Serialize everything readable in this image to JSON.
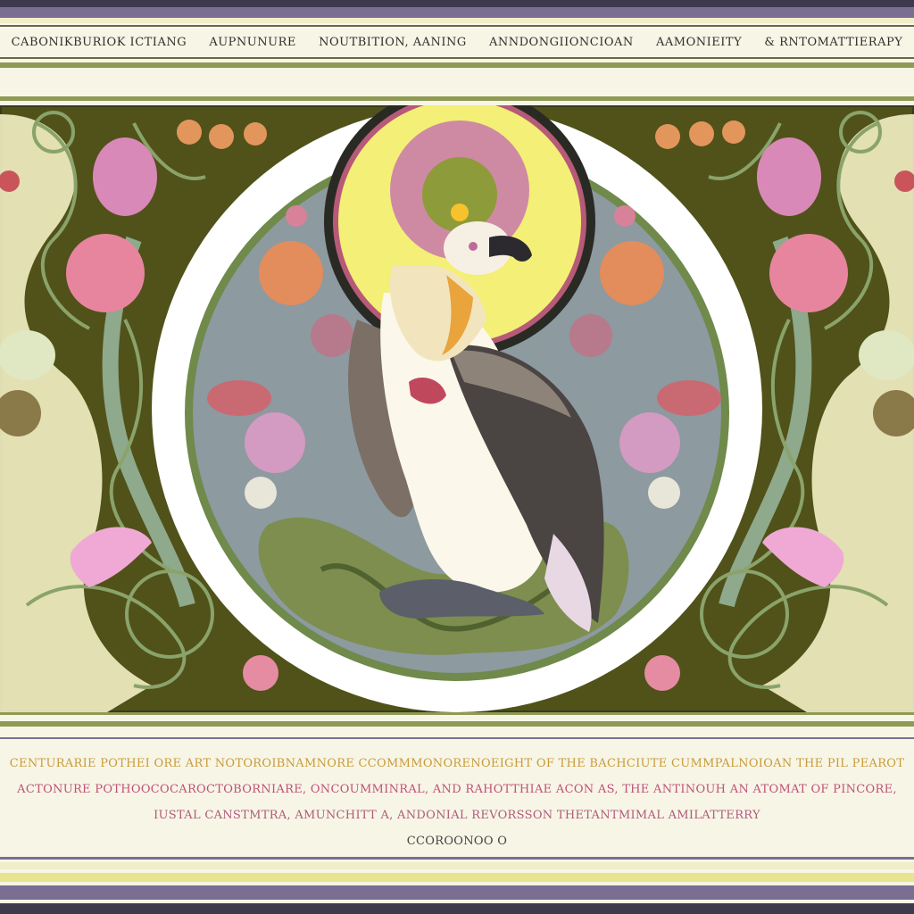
{
  "header": {
    "items": [
      "CABONIKBURIOK ICTIANG",
      "AUPNUNURE",
      "NOUTBITION, AANING",
      "ANNDONGIIONCIOAN",
      "AAMONIEITY",
      "& RNTOMATTIERAPY"
    ]
  },
  "caption": {
    "line1": "CENTURARIE POTHEI ORE ART NOTOROIBNAMNORE CCOMMMONORENOEIGHT OF THE BACHCIUTE CUMMPALNOIOAN THE PIL PEAROT",
    "line2": "ACTONURE POTHOOCOCAROCTOBORNIARE, ONCOUMMINRAL, AND RAHOTTHIAE ACON AS, THE ANTINOUH AN ATOMAT OF PINCORE,",
    "line3": "IUSTAL CANSTMTRA, AMUNCHITT A, ANDONIAL REVORSSON THETANTMIMAL AMILATTERRY",
    "signature": "CCOROONOO O"
  },
  "colors": {
    "background": "#f7f6e6",
    "stripe_purple": "#7a6f93",
    "stripe_olive": "#8f9a55",
    "panel_olive": "#50521a",
    "halo_yellow": "#f4ef76",
    "medallion_blue": "#8d9aa0",
    "ring_white": "#ffffff",
    "flower_pink": "#e58ca3",
    "flower_orange": "#e3965c",
    "flower_lilac": "#c98ccb"
  }
}
